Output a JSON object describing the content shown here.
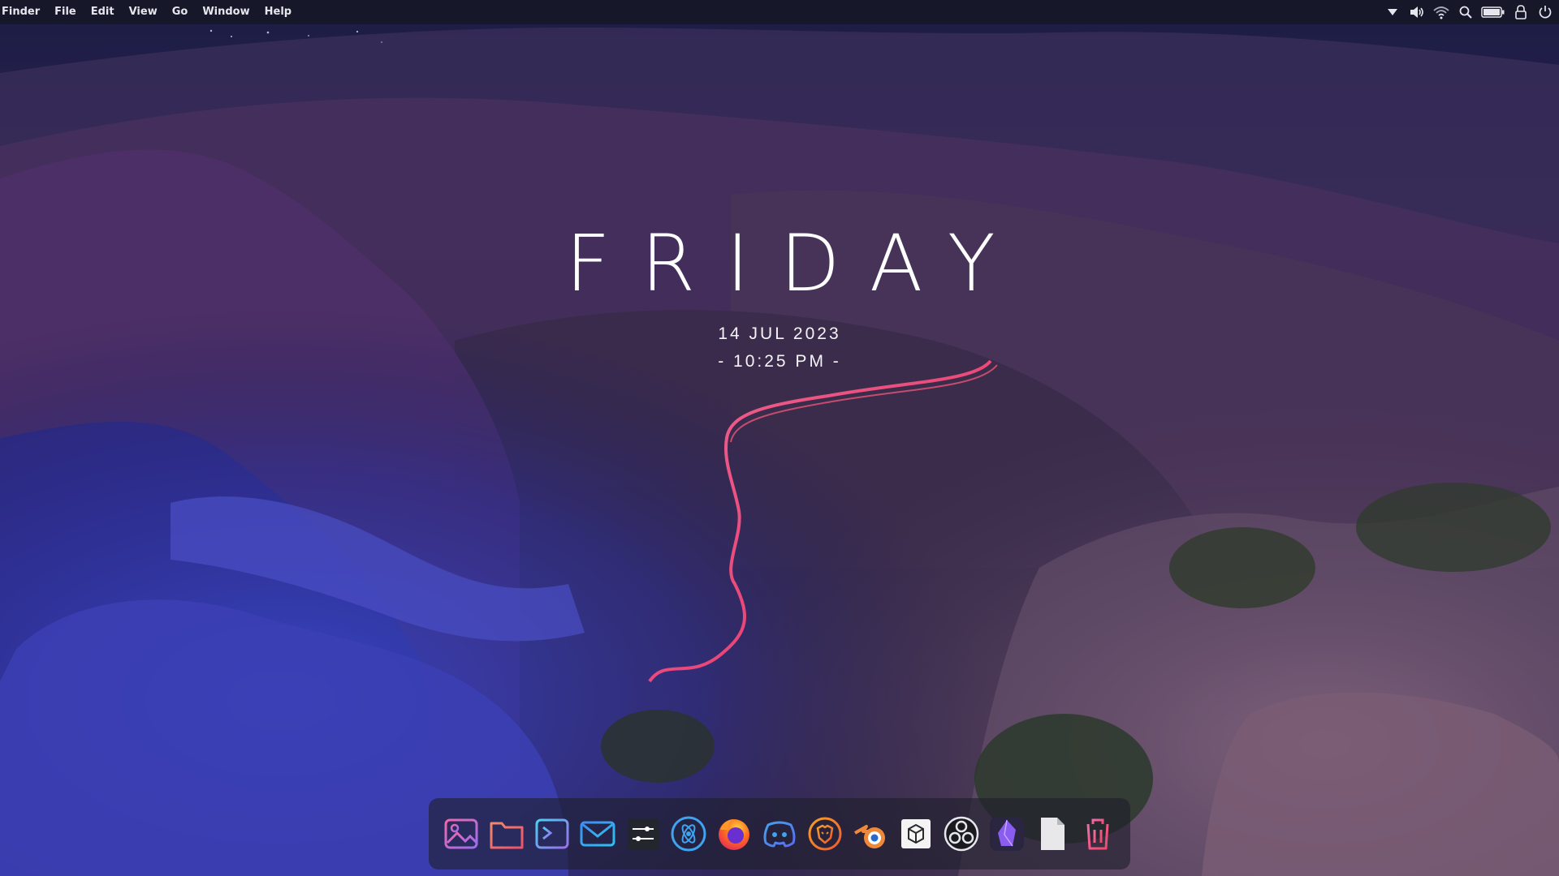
{
  "menubar": {
    "items": [
      "Finder",
      "File",
      "Edit",
      "View",
      "Go",
      "Window",
      "Help"
    ],
    "tray_icons": [
      "dropdown-arrow-icon",
      "volume-icon",
      "wifi-icon",
      "search-icon",
      "battery-icon",
      "lock-icon",
      "power-icon"
    ]
  },
  "clock": {
    "day": "FRIDAY",
    "date": "14 JUL 2023",
    "time": "- 10:25 PM -"
  },
  "dock": {
    "apps": [
      "image-viewer-icon",
      "files-folder-icon",
      "terminal-icon",
      "mail-icon",
      "settings-sliders-icon",
      "atom-circle-icon",
      "firefox-icon",
      "discord-icon",
      "brave-lion-icon",
      "blender-icon",
      "package-box-icon",
      "obs-icon",
      "obsidian-crystal-icon",
      "text-document-icon",
      "trash-icon"
    ]
  },
  "colors": {
    "menubar_bg": "#16172a",
    "accent_pink": "#ee5a9e",
    "accent_orange": "#f0883a",
    "accent_blue": "#3fa3f0"
  }
}
